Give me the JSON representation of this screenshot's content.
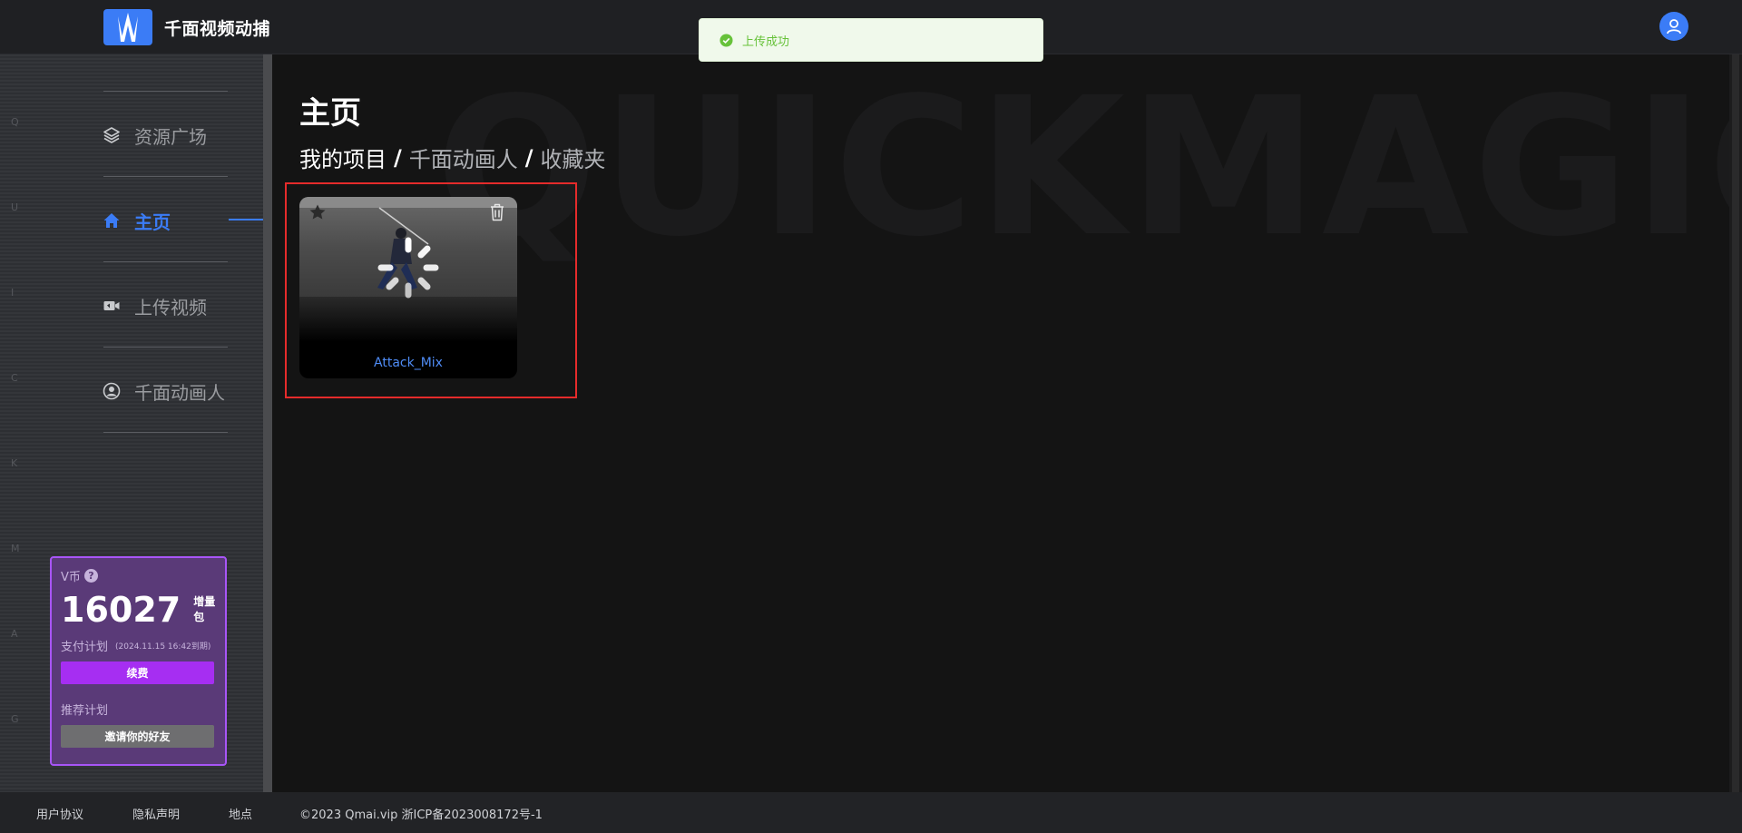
{
  "header": {
    "app_title": "千面视频动捕"
  },
  "toast": {
    "message": "上传成功"
  },
  "sidebar": {
    "side_letters": [
      "Q",
      "U",
      "I",
      "C",
      "K",
      "M",
      "A",
      "G"
    ],
    "items": [
      {
        "label": "资源广场",
        "icon": "layers-icon"
      },
      {
        "label": "主页",
        "icon": "home-icon",
        "active": true
      },
      {
        "label": "上传视频",
        "icon": "video-icon"
      },
      {
        "label": "千面动画人",
        "icon": "user-circle-icon"
      }
    ]
  },
  "vip_card": {
    "label": "V币",
    "help": "?",
    "amount": "16027",
    "tag": "增量包",
    "plan_label": "支付计划",
    "plan_date": "(2024.11.15 16:42到期)",
    "renew_label": "续费",
    "referral_label": "推荐计划",
    "invite_label": "邀请你的好友"
  },
  "main": {
    "watermark": "QUICKMAGIC",
    "page_title": "主页",
    "breadcrumbs": [
      "我的项目",
      "千面动画人",
      "收藏夹"
    ],
    "separator": "/",
    "projects": [
      {
        "name": "Attack_Mix"
      }
    ]
  },
  "footer": {
    "links": [
      "用户协议",
      "隐私声明",
      "地点"
    ],
    "copyright": "©2023 Qmai.vip 浙ICP备2023008172号-1"
  }
}
